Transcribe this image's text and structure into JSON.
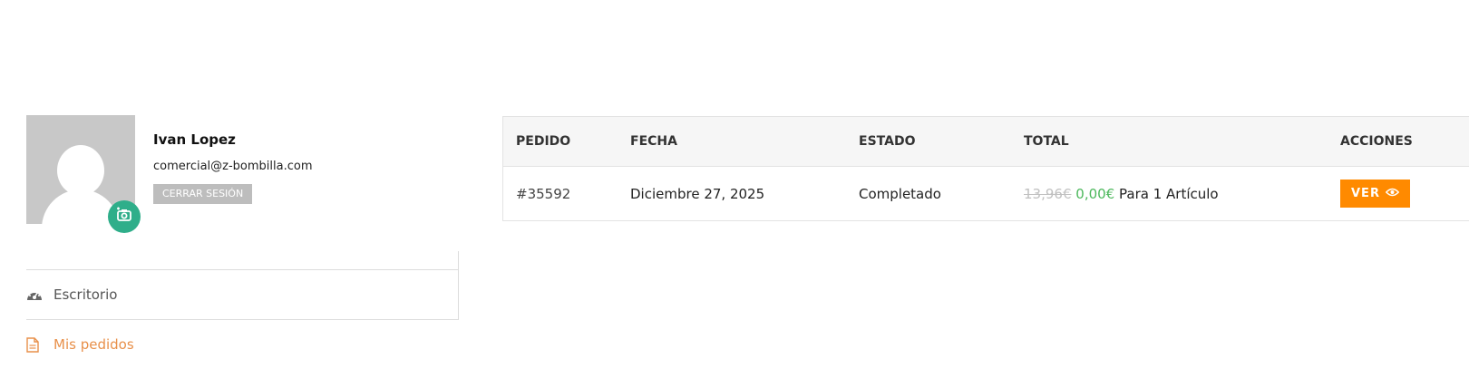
{
  "user": {
    "name": "Ivan Lopez",
    "email": "comercial@z-bombilla.com",
    "logout_label": "CERRAR SESIÓN"
  },
  "nav": {
    "items": [
      {
        "label": "Escritorio",
        "icon": "dashboard-gauge-icon",
        "active": false
      },
      {
        "label": "Mis pedidos",
        "icon": "document-icon",
        "active": true
      }
    ]
  },
  "orders": {
    "columns": [
      "PEDIDO",
      "FECHA",
      "ESTADO",
      "TOTAL",
      "ACCIONES"
    ],
    "rows": [
      {
        "order": "#35592",
        "date": "Diciembre 27, 2025",
        "status": "Completado",
        "price_old": "13,96€",
        "price_new": "0,00€",
        "items_text": "Para 1 Artículo",
        "action_label": "VER"
      }
    ]
  },
  "colors": {
    "accent_orange": "#ff8a00",
    "link_orange": "#e8904a",
    "camera_green": "#2fae8a",
    "price_green": "#4cb85c"
  }
}
